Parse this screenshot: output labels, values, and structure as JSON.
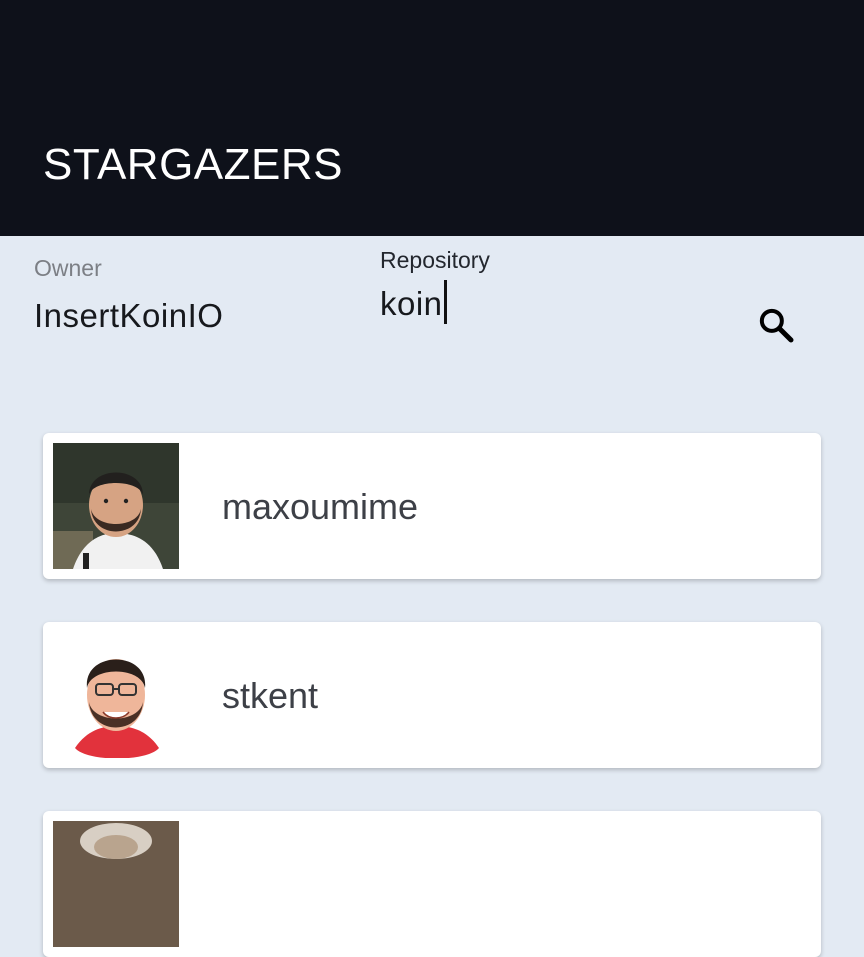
{
  "app": {
    "title": "STARGAZERS"
  },
  "form": {
    "owner_label": "Owner",
    "owner_value": "InsertKoinIO",
    "repo_label": "Repository",
    "repo_value": "koin",
    "search_icon": "search-icon"
  },
  "stargazers": [
    {
      "login": "maxoumime",
      "avatar": "avatar-photo"
    },
    {
      "login": "stkent",
      "avatar": "avatar-photo"
    },
    {
      "login": "",
      "avatar": "avatar-photo"
    }
  ],
  "colors": {
    "app_bar": "#0e111a",
    "background": "#e3eaf3",
    "card": "#ffffff"
  }
}
